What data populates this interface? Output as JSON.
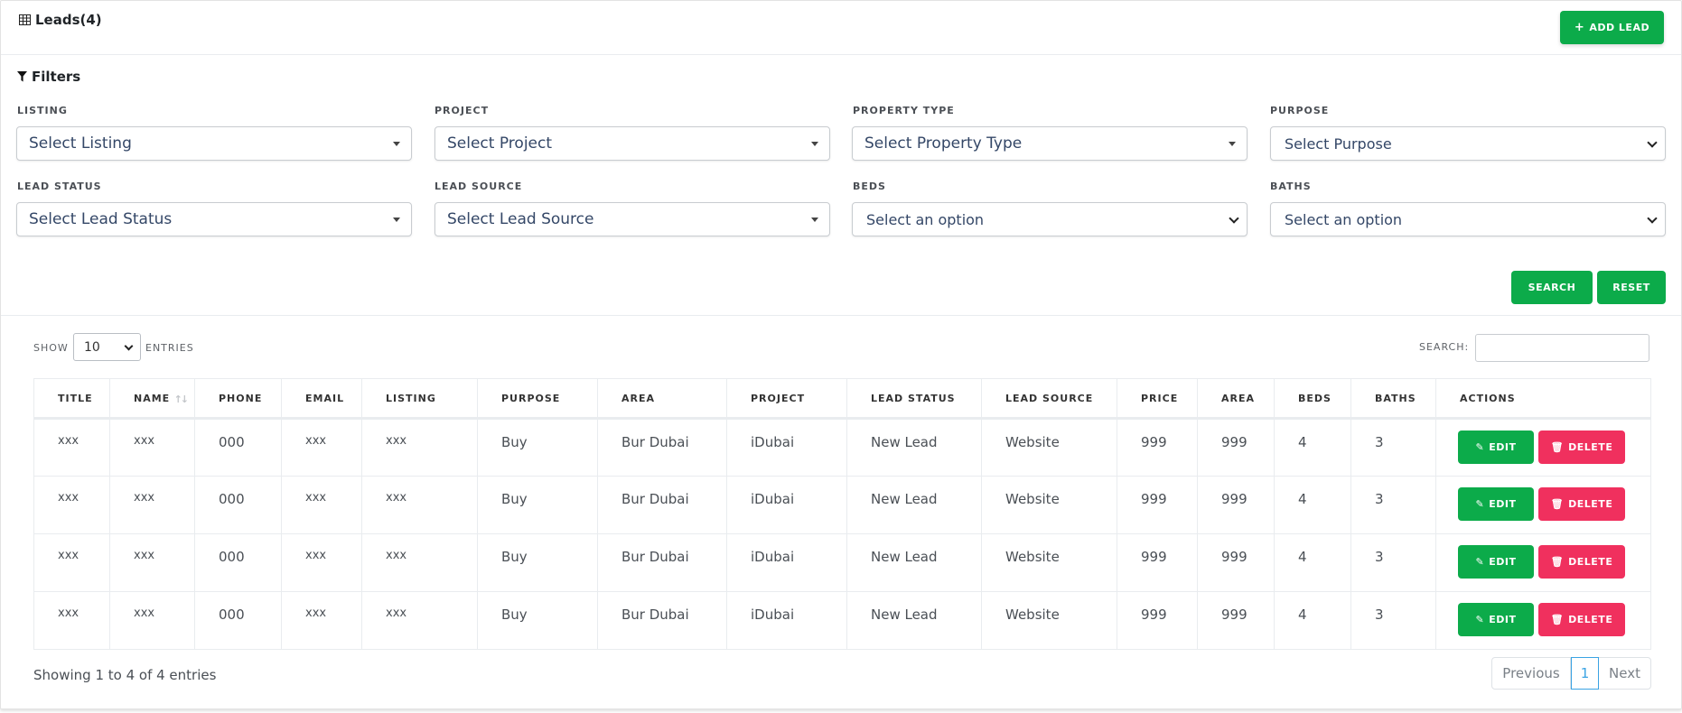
{
  "header": {
    "title": "Leads(4)",
    "add_label": "ADD LEAD"
  },
  "filters": {
    "title": "Filters",
    "fields": [
      {
        "label": "LISTING",
        "value": "Select Listing"
      },
      {
        "label": "PROJECT",
        "value": "Select Project"
      },
      {
        "label": "PROPERTY TYPE",
        "value": "Select Property Type"
      },
      {
        "label": "PURPOSE",
        "value": "Select Purpose"
      },
      {
        "label": "LEAD STATUS",
        "value": "Select Lead Status"
      },
      {
        "label": "LEAD SOURCE",
        "value": "Select Lead Source"
      },
      {
        "label": "BEDS",
        "value": "Select an option"
      },
      {
        "label": "BATHS",
        "value": "Select an option"
      }
    ],
    "search_label": "SEARCH",
    "reset_label": "RESET"
  },
  "table_controls": {
    "show_label": "SHOW",
    "length_value": "10",
    "entries_label": "ENTRIES",
    "search_label": "SEARCH:"
  },
  "table": {
    "columns": [
      "TITLE",
      "NAME",
      "PHONE",
      "EMAIL",
      "LISTING",
      "PURPOSE",
      "AREA",
      "PROJECT",
      "LEAD STATUS",
      "LEAD SOURCE",
      "PRICE",
      "AREA",
      "BEDS",
      "BATHS",
      "ACTIONS"
    ],
    "rows": [
      [
        "xxx",
        "xxx",
        "000",
        "xxx",
        "xxx",
        "Buy",
        "Bur Dubai",
        "iDubai",
        "New Lead",
        "Website",
        "999",
        "999",
        "4",
        "3"
      ],
      [
        "xxx",
        "xxx",
        "000",
        "xxx",
        "xxx",
        "Buy",
        "Bur Dubai",
        "iDubai",
        "New Lead",
        "Website",
        "999",
        "999",
        "4",
        "3"
      ],
      [
        "xxx",
        "xxx",
        "000",
        "xxx",
        "xxx",
        "Buy",
        "Bur Dubai",
        "iDubai",
        "New Lead",
        "Website",
        "999",
        "999",
        "4",
        "3"
      ],
      [
        "xxx",
        "xxx",
        "000",
        "xxx",
        "xxx",
        "Buy",
        "Bur Dubai",
        "iDubai",
        "New Lead",
        "Website",
        "999",
        "999",
        "4",
        "3"
      ]
    ],
    "edit_label": "EDIT",
    "delete_label": "DELETE"
  },
  "footer": {
    "info": "Showing 1 to 4 of 4 entries",
    "previous": "Previous",
    "current_page": "1",
    "next": "Next"
  },
  "colors": {
    "green": "#0cab4a",
    "red": "#f0305e",
    "page_active": "#3aa3e3"
  }
}
